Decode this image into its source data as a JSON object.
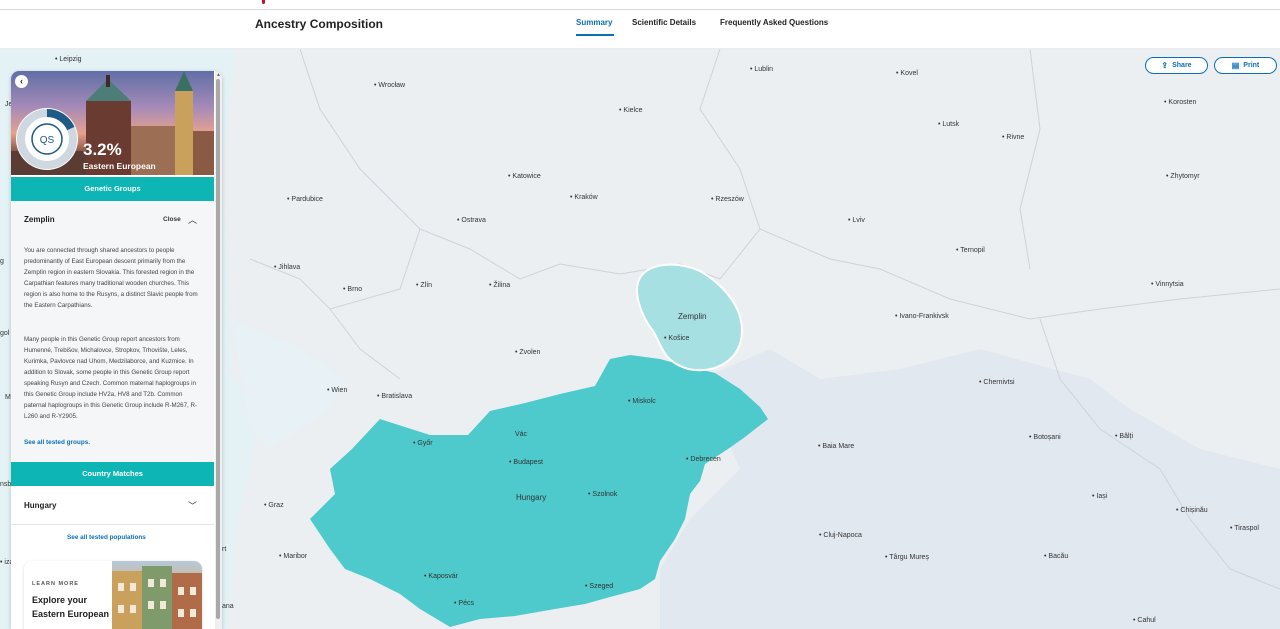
{
  "header": {
    "title": "Ancestry Composition",
    "tabs": [
      {
        "label": "Summary",
        "active": true
      },
      {
        "label": "Scientific Details",
        "active": false
      },
      {
        "label": "Frequently Asked Questions",
        "active": false
      }
    ]
  },
  "toolbar": {
    "share_label": "Share",
    "print_label": "Print"
  },
  "map": {
    "highlight_color": "#4ec9cc",
    "cities": [
      "Leipzig",
      "Wrocław",
      "Lublin",
      "Kovel",
      "Korosten",
      "Kielce",
      "Lutsk",
      "Rivne",
      "Katowice",
      "Kraków",
      "Rzeszów",
      "Zhytomyr",
      "Pardubice",
      "Ostrava",
      "Lviv",
      "Ternopil",
      "Jihlava",
      "Brno",
      "Zlín",
      "Žilina",
      "Vinnytsia",
      "Ivano-Frankivsk",
      "Košice",
      "Zvolen",
      "Wien",
      "Bratislava",
      "Miskolc",
      "Chernivtsi",
      "Győr",
      "Vác",
      "Budapest",
      "Debrecen",
      "Baia Mare",
      "Botoșani",
      "Bălți",
      "Hungary",
      "Szolnok",
      "Iași",
      "Graz",
      "Chișinău",
      "Tiraspol",
      "Cluj-Napoca",
      "Maribor",
      "Târgu Mureș",
      "Bacău",
      "Kaposvár",
      "Szeged",
      "Pécs",
      "Cahul",
      "Je",
      "g",
      "gol",
      "M",
      "nsb",
      "rt",
      "izar",
      "ana"
    ],
    "region_label": "Zemplin",
    "country_label": "Hungary"
  },
  "panel": {
    "percentage": "3.2%",
    "population": "Eastern European",
    "badge_text": "QS",
    "genetic_groups_heading": "Genetic Groups",
    "group_name": "Zemplin",
    "close_label": "Close",
    "description_1": "You are connected through shared ancestors to people predominantly of East European descent primarily from the Zemplín region in eastern Slovakia. This forested region in the Carpathian features many traditional wooden churches. This region is also home to the Rusyns, a distinct Slavic people from the Eastern Carpathians.",
    "description_2": "Many people in this Genetic Group report ancestors from Humenné, Trebišov, Michalovce, Stropkov, Trhovište, Leles, Kurimka, Pavlovce nad Uhom, Medzilaborce, and Kuzmice. In addition to Slovak, some people in this Genetic Group report speaking Rusyn and Czech. Common maternal haplogroups in this Genetic Group include HV2a, HV8 and T2b. Common paternal haplogroups in this Genetic Group include R-M267, R-L260 and R-Y2905.",
    "see_groups_link": "See all tested groups.",
    "country_matches_heading": "Country Matches",
    "country": "Hungary",
    "see_populations_link": "See all tested populations",
    "learn_more_eyebrow": "LEARN MORE",
    "learn_more_title": "Explore your Eastern European"
  }
}
